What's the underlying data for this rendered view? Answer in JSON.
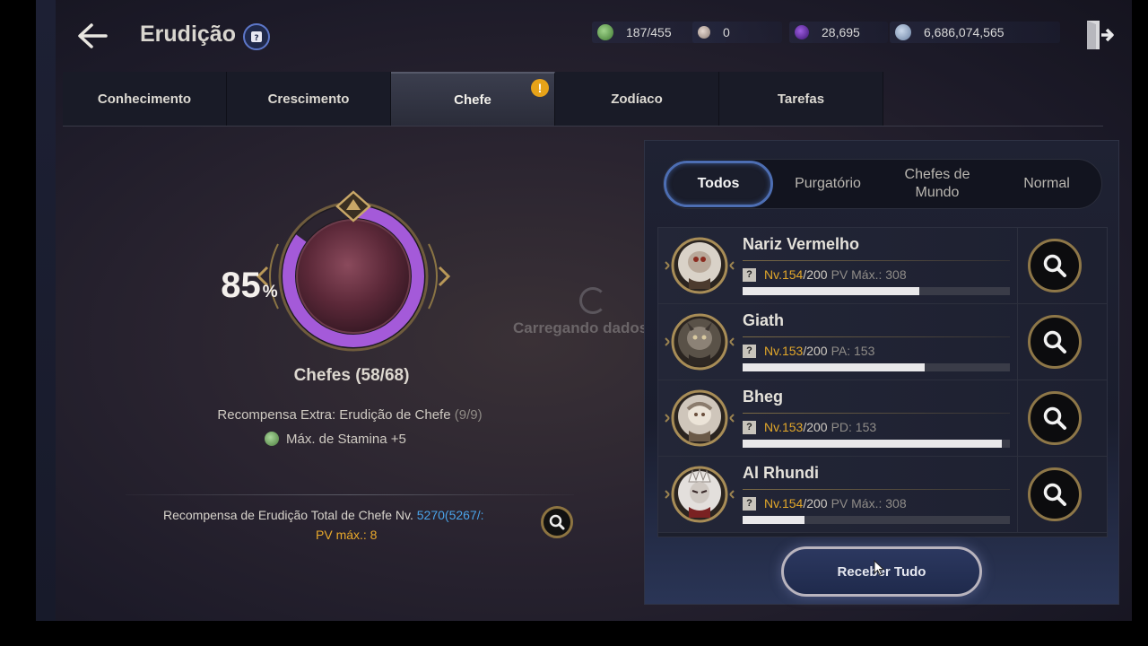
{
  "header": {
    "title": "Erudição",
    "currencies": [
      {
        "icon": "stamina-icon",
        "value": "187/455",
        "color": "#6fb35a"
      },
      {
        "icon": "orb-icon",
        "value": "0",
        "color": "#c9b8b0"
      },
      {
        "icon": "purple-gem-icon",
        "value": "28,695",
        "color": "#6b2bb5"
      },
      {
        "icon": "silver-coin-icon",
        "value": "6,686,074,565",
        "color": "#8fa6c6"
      }
    ]
  },
  "tabs": [
    {
      "label": "Conhecimento",
      "active": false
    },
    {
      "label": "Crescimento",
      "active": false
    },
    {
      "label": "Chefe",
      "active": true,
      "alert": "!"
    },
    {
      "label": "Zodíaco",
      "active": false
    },
    {
      "label": "Tarefas",
      "active": false
    }
  ],
  "progress": {
    "percent": 85,
    "percent_number": "85",
    "percent_sign": "%",
    "count_label": "Chefes (58/68)"
  },
  "extra_reward": {
    "label": "Recompensa Extra: Erudição de Chefe",
    "count": "(9/9)",
    "stat": "Máx. de Stamina +5"
  },
  "total_reward": {
    "label": "Recompensa de Erudição Total de Chefe Nv.",
    "value": "5270(5267/:",
    "stat": "PV máx.: 8"
  },
  "loading_text": "Carregando dados...",
  "filters": [
    {
      "label": "Todos",
      "active": true
    },
    {
      "label": "Purgatório",
      "active": false
    },
    {
      "label": "Chefes de Mundo",
      "active": false
    },
    {
      "label": "Normal",
      "active": false
    }
  ],
  "bosses": [
    {
      "name": "Nariz Vermelho",
      "lv_prefix": "Nv. ",
      "lv": "154",
      "lv_max": "/200",
      "stat": "PV Máx.: 308",
      "progress": 0.66
    },
    {
      "name": "Giath",
      "lv_prefix": "Nv. ",
      "lv": "153",
      "lv_max": "/200",
      "stat": "PA: 153",
      "progress": 0.68
    },
    {
      "name": "Bheg",
      "lv_prefix": "Nv. ",
      "lv": "153",
      "lv_max": "/200",
      "stat": "PD: 153",
      "progress": 0.97
    },
    {
      "name": "Al Rhundi",
      "lv_prefix": "Nv. ",
      "lv": "154",
      "lv_max": "/200",
      "stat": "PV Máx.: 308",
      "progress": 0.23
    }
  ],
  "receive_all_label": "Receber Tudo",
  "colors": {
    "accent_gold": "#e2a72a",
    "accent_blue": "#4aa3e8",
    "ring_purple": "#a45ad9",
    "alert_orange": "#e7a319"
  }
}
